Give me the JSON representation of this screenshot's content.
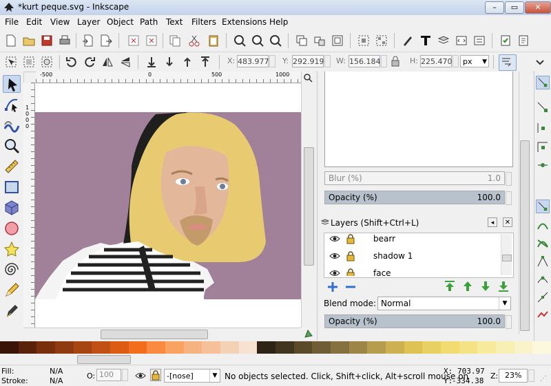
{
  "window": {
    "title": "*kurt peque.svg - Inkscape",
    "minimize": "–",
    "maximize": "▭",
    "close": "✕"
  },
  "menu": [
    "File",
    "Edit",
    "View",
    "Layer",
    "Object",
    "Path",
    "Text",
    "Filters",
    "Extensions",
    "Help"
  ],
  "toolbar2": {
    "x_label": "X:",
    "x_value": "483.977",
    "y_label": "Y:",
    "y_value": "292.919",
    "w_label": "W:",
    "w_value": "156.184",
    "h_label": "H:",
    "h_value": "225.470",
    "unit": "px"
  },
  "ruler": {
    "h_ticks": [
      "-500",
      "0",
      "500",
      "1000"
    ],
    "v_ticks": [
      "1",
      "0",
      "0",
      "0"
    ]
  },
  "dock": {
    "blur_label": "Blur (%)",
    "blur_value": "1.0",
    "opacity_label": "Opacity (%)",
    "opacity_value": "100.0",
    "layers_title": "Layers (Shift+Ctrl+L)",
    "layers": [
      {
        "name": "bearr"
      },
      {
        "name": "shadow 1"
      },
      {
        "name": "face"
      }
    ],
    "blend_label": "Blend mode:",
    "blend_value": "Normal",
    "layer_opacity_label": "Opacity (%)",
    "layer_opacity_value": "100.0"
  },
  "palette": [
    "#3b1408",
    "#5a2309",
    "#7a2f0c",
    "#8f3a10",
    "#a64512",
    "#c05014",
    "#dc5c14",
    "#f26d1c",
    "#f98a40",
    "#f9a262",
    "#f6b381",
    "#f5c09a",
    "#f4d0b4",
    "#f7e2d2",
    "#2d2416",
    "#42351f",
    "#5a4a2a",
    "#6e5d35",
    "#857040",
    "#9c8546",
    "#b59c4e",
    "#cdb050",
    "#dec254",
    "#e9d062",
    "#f2dc72",
    "#f4e385",
    "#f7ea9c",
    "#f8efb4",
    "#faf3c9",
    "#fcf8de"
  ],
  "status": {
    "fill_label": "Fill:",
    "fill_value": "N/A",
    "stroke_label": "Stroke:",
    "stroke_value": "N/A",
    "o_label": "O:",
    "o_value": "100",
    "layer_value": "-[nose]",
    "message": "No objects selected. Click, Shift+click, Alt+scroll mouse on",
    "x_label": "X:",
    "x_value": "703.97",
    "y_label": "Y:",
    "y_value": "-334.38",
    "z_label": "Z:",
    "z_value": "23%"
  }
}
